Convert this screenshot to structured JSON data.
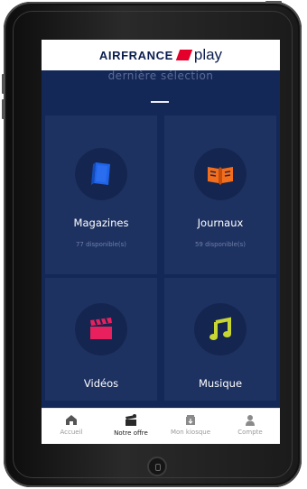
{
  "app": {
    "brand_name": "AIRFRANCE",
    "brand_suffix": "play",
    "brand_color": "#0b1e4f",
    "accent_color": "#e4002b",
    "background_color": "#142858"
  },
  "section": {
    "title": "dernière sélection"
  },
  "tiles": [
    {
      "label": "Magazines",
      "subtitle": "77 disponible(s)",
      "icon": "magazine-icon",
      "icon_color": "#1e63e8"
    },
    {
      "label": "Journaux",
      "subtitle": "59 disponible(s)",
      "icon": "open-book-icon",
      "icon_color": "#f26d1c"
    },
    {
      "label": "Vidéos",
      "subtitle": "",
      "icon": "clapperboard-icon",
      "icon_color": "#e8215e"
    },
    {
      "label": "Musique",
      "subtitle": "",
      "icon": "music-note-icon",
      "icon_color": "#c7d633"
    }
  ],
  "tabs": [
    {
      "label": "Accueil",
      "icon": "home-icon",
      "active": false
    },
    {
      "label": "Notre offre",
      "icon": "offer-icon",
      "active": true
    },
    {
      "label": "Mon kiosque",
      "icon": "kiosk-icon",
      "active": false
    },
    {
      "label": "Compte",
      "icon": "user-icon",
      "active": false
    }
  ]
}
